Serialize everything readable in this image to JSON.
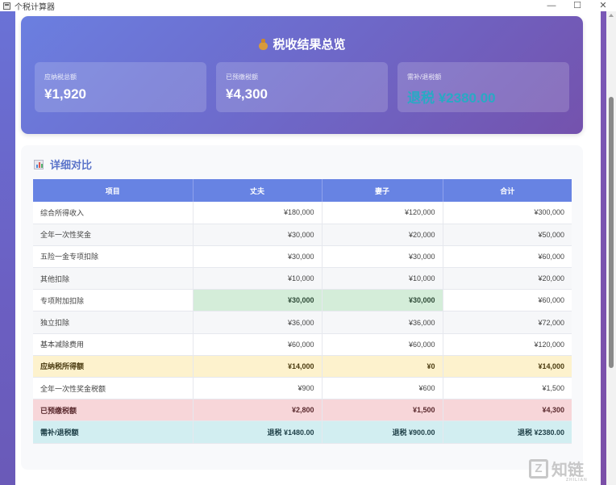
{
  "window": {
    "title": "个税计算器",
    "minimize": "—",
    "maximize": "☐",
    "close": "✕"
  },
  "summary": {
    "icon": "moneybag-icon",
    "title": "税收结果总览",
    "cards": [
      {
        "label": "应纳税总额",
        "value": "¥1,920"
      },
      {
        "label": "已预缴税额",
        "value": "¥4,300"
      },
      {
        "label": "需补/退税额",
        "value": "退税 ¥2380.00"
      }
    ]
  },
  "detail": {
    "icon": "bar-chart-icon",
    "title": "详细对比",
    "columns": [
      "项目",
      "丈夫",
      "妻子",
      "合计"
    ],
    "rows": [
      [
        "综合所得收入",
        "¥180,000",
        "¥120,000",
        "¥300,000"
      ],
      [
        "全年一次性奖金",
        "¥30,000",
        "¥20,000",
        "¥50,000"
      ],
      [
        "五险一金专项扣除",
        "¥30,000",
        "¥30,000",
        "¥60,000"
      ],
      [
        "其他扣除",
        "¥10,000",
        "¥10,000",
        "¥20,000"
      ],
      [
        "专项附加扣除",
        "¥30,000",
        "¥30,000",
        "¥60,000"
      ],
      [
        "独立扣除",
        "¥36,000",
        "¥36,000",
        "¥72,000"
      ],
      [
        "基本减除费用",
        "¥60,000",
        "¥60,000",
        "¥120,000"
      ],
      [
        "应纳税所得额",
        "¥14,000",
        "¥0",
        "¥14,000"
      ],
      [
        "全年一次性奖金税额",
        "¥900",
        "¥600",
        "¥1,500"
      ],
      [
        "已预缴税额",
        "¥2,800",
        "¥1,500",
        "¥4,300"
      ],
      [
        "需补/退税额",
        "退税 ¥1480.00",
        "退税 ¥900.00",
        "退税 ¥2380.00"
      ]
    ]
  },
  "watermark": {
    "mark": "Z",
    "text": "知链",
    "sub": "ZHILIAN"
  },
  "colors": {
    "header": "#6783e3",
    "highlight_green": "#d4edd9",
    "highlight_yellow": "#fdf2cd",
    "highlight_pink": "#f7d6d9",
    "highlight_cyan": "#d2eef1",
    "refund_text": "#29a9c4"
  }
}
